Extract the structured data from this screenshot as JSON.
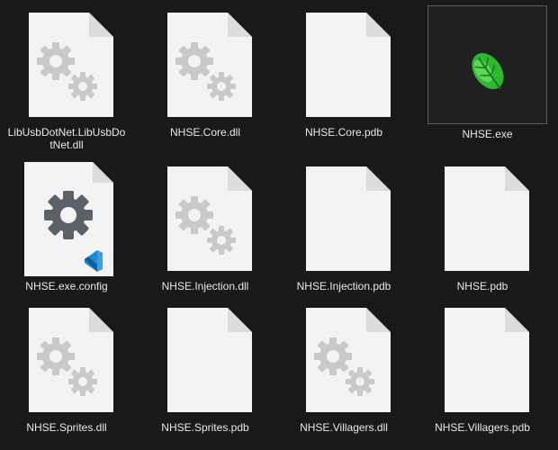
{
  "theme": {
    "background": "#191919",
    "page": "#f3f3f3",
    "fold": "#dcdcdc",
    "gear": "#c9c9c9",
    "config_gear": "#5b6167",
    "vscode_blue": "#1f8ad2",
    "leaf_green": "#2db82f"
  },
  "files": [
    {
      "name": "LibUsbDotNet.LibUsbDotNet.dll",
      "icon": "dll-gears-icon"
    },
    {
      "name": "NHSE.Core.dll",
      "icon": "dll-gears-icon"
    },
    {
      "name": "NHSE.Core.pdb",
      "icon": "blank-file-icon"
    },
    {
      "name": "NHSE.exe",
      "icon": "leaf-app-icon"
    },
    {
      "name": "NHSE.exe.config",
      "icon": "config-file-icon"
    },
    {
      "name": "NHSE.Injection.dll",
      "icon": "dll-gears-icon"
    },
    {
      "name": "NHSE.Injection.pdb",
      "icon": "blank-file-icon"
    },
    {
      "name": "NHSE.pdb",
      "icon": "blank-file-icon"
    },
    {
      "name": "NHSE.Sprites.dll",
      "icon": "dll-gears-icon"
    },
    {
      "name": "NHSE.Sprites.pdb",
      "icon": "blank-file-icon"
    },
    {
      "name": "NHSE.Villagers.dll",
      "icon": "dll-gears-icon"
    },
    {
      "name": "NHSE.Villagers.pdb",
      "icon": "blank-file-icon"
    }
  ]
}
